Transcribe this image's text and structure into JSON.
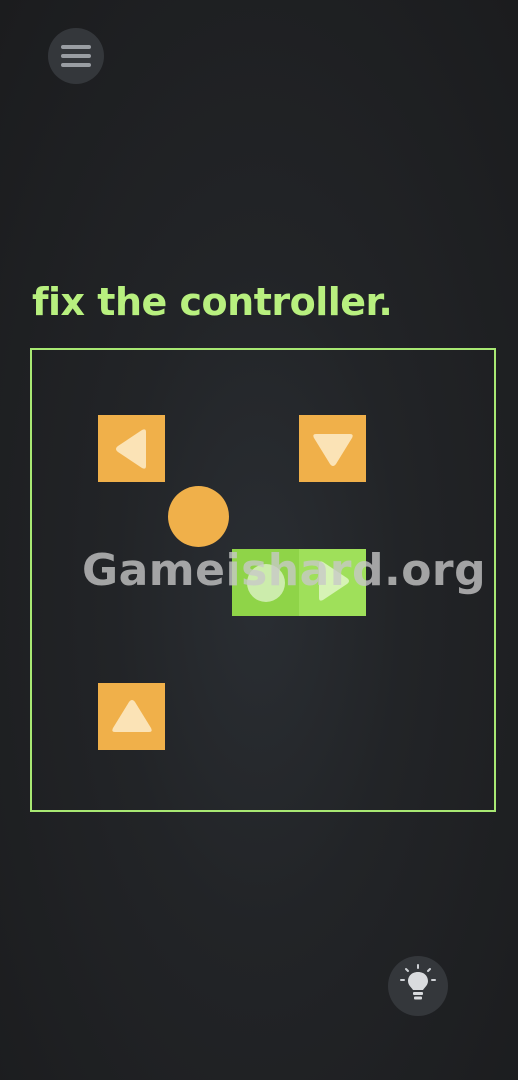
{
  "header": {
    "menu_icon": "hamburger-menu-icon"
  },
  "puzzle": {
    "title": "fix the controller."
  },
  "board": {
    "pieces": [
      {
        "name": "left-arrow-piece",
        "icon": "triangle-left-icon",
        "color": "#f0b04a"
      },
      {
        "name": "down-arrow-piece",
        "icon": "triangle-down-icon",
        "color": "#f0b04a"
      },
      {
        "name": "right-arrow-piece",
        "icon": "triangle-right-icon",
        "color": "#9fe05a"
      },
      {
        "name": "up-arrow-piece",
        "icon": "triangle-up-icon",
        "color": "#f0b04a"
      }
    ],
    "ball_color": "#f0b04a",
    "accent": "#b8f07f"
  },
  "watermark": {
    "text": "Gameishard.org"
  },
  "footer": {
    "hint_icon": "lightbulb-icon"
  }
}
